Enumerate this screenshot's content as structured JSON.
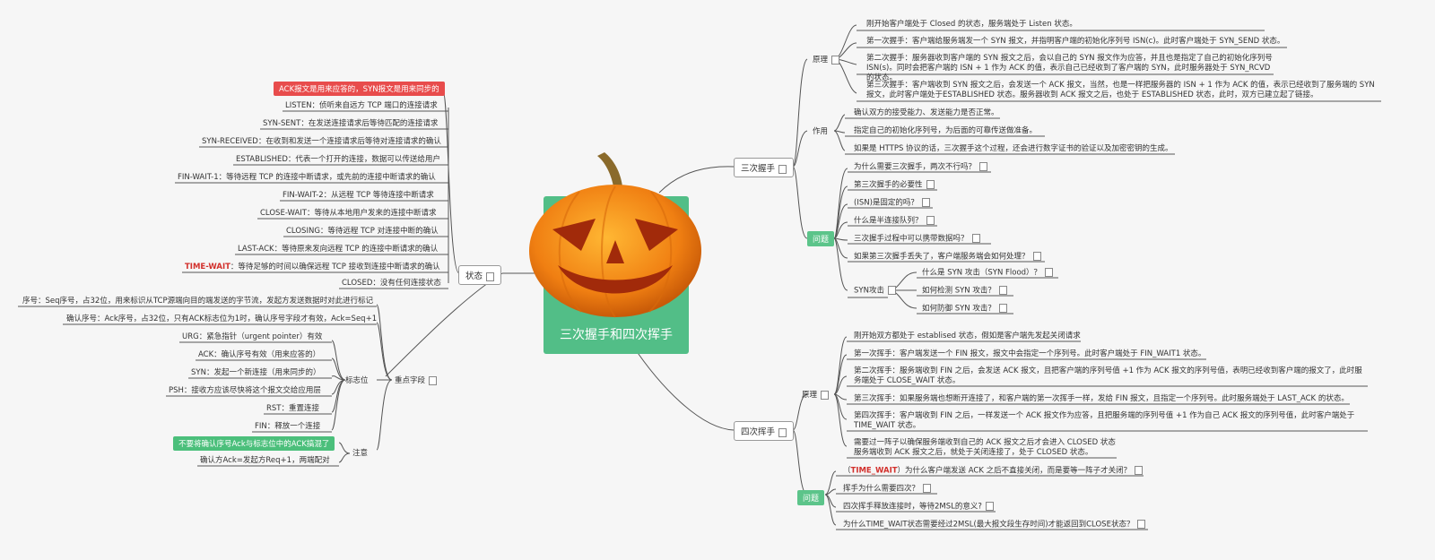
{
  "center": {
    "title": "三次握手和四次挥手"
  },
  "three_way": {
    "label": "三次握手",
    "principle": {
      "label": "原理",
      "items": [
        "刚开始客户端处于 Closed 的状态，服务端处于 Listen 状态。",
        "第一次握手：客户端给服务端发一个 SYN 报文，并指明客户端的初始化序列号 ISN(c)。此时客户端处于 SYN_SEND 状态。",
        "第二次握手：服务器收到客户端的 SYN 报文之后，会以自己的 SYN 报文作为应答，并且也是指定了自己的初始化序列号 ISN(s)。同时会把客户端的 ISN + 1 作为 ACK 的值，表示自己已经收到了客户端的 SYN，此时服务器处于 SYN_RCVD 的状态。",
        "第三次握手：客户端收到 SYN 报文之后，会发送一个 ACK 报文，当然，也是一样把服务器的 ISN + 1 作为 ACK 的值，表示已经收到了服务端的 SYN 报文，此时客户端处于ESTABLISHED 状态。服务器收到 ACK 报文之后，也处于 ESTABLISHED 状态，此时，双方已建立起了链接。"
      ]
    },
    "role": {
      "label": "作用",
      "items": [
        "确认双方的接受能力、发送能力是否正常。",
        "指定自己的初始化序列号，为后面的可靠传送做准备。",
        "如果是 HTTPS 协议的话，三次握手这个过程，还会进行数字证书的验证以及加密密钥的生成。"
      ]
    },
    "questions": {
      "label": "问题",
      "items": [
        "为什么需要三次握手，两次不行吗？",
        "第三次握手的必要性",
        "(ISN)是固定的吗？",
        "什么是半连接队列？",
        "三次握手过程中可以携带数据吗？",
        "如果第三次握手丢失了，客户端服务端会如何处理？"
      ],
      "syn": {
        "label": "SYN攻击",
        "items": [
          "什么是 SYN 攻击（SYN Flood）？",
          "如何检测 SYN 攻击？",
          "如何防御 SYN 攻击？"
        ]
      }
    }
  },
  "four_way": {
    "label": "四次挥手",
    "principle": {
      "label": "原理",
      "items": [
        "刚开始双方都处于 establised 状态，假如是客户端先发起关闭请求",
        "第一次挥手：客户端发送一个 FIN 报文，报文中会指定一个序列号。此时客户端处于 FIN_WAIT1 状态。",
        "第二次挥手：服务端收到 FIN 之后，会发送 ACK 报文，且把客户端的序列号值 +1 作为 ACK 报文的序列号值，表明已经收到客户端的报文了，此时服务端处于 CLOSE_WAIT 状态。",
        "第三次挥手：如果服务端也想断开连接了，和客户端的第一次挥手一样，发给 FIN 报文，且指定一个序列号。此时服务端处于 LAST_ACK 的状态。",
        "第四次挥手：客户端收到 FIN 之后，一样发送一个 ACK 报文作为应答，且把服务端的序列号值 +1 作为自己 ACK 报文的序列号值，此时客户端处于 TIME_WAIT 状态。",
        "需要过一阵子以确保服务端收到自己的 ACK 报文之后才会进入 CLOSED 状态\n服务端收到 ACK 报文之后，就处于关闭连接了，处于 CLOSED 状态。"
      ]
    },
    "questions": {
      "label": "问题",
      "items": [
        "（TIME_WAIT）为什么客户端发送 ACK 之后不直接关闭，而是要等一阵子才关闭？",
        "挥手为什么需要四次？",
        "四次挥手释放连接时，等待2MSL的意义?",
        "为什么TIME_WAIT状态需要经过2MSL(最大报文段生存时间)才能返回到CLOSE状态？"
      ]
    }
  },
  "states": {
    "label": "状态",
    "note": "ACK报文是用来应答的，SYN报文是用来同步的",
    "items": [
      "LISTEN：侦听来自远方 TCP 端口的连接请求",
      "SYN-SENT：在发送连接请求后等待匹配的连接请求",
      "SYN-RECEIVED：在收到和发送一个连接请求后等待对连接请求的确认",
      "ESTABLISHED：代表一个打开的连接，数据可以传送给用户",
      "FIN-WAIT-1：等待远程 TCP 的连接中断请求，或先前的连接中断请求的确认",
      "FIN-WAIT-2：从远程 TCP 等待连接中断请求",
      "CLOSE-WAIT：等待从本地用户发来的连接中断请求",
      "CLOSING：等待远程 TCP 对连接中断的确认",
      "LAST-ACK：等待原来发向远程 TCP 的连接中断请求的确认",
      "TIME-WAIT：等待足够的时间以确保远程 TCP 接收到连接中断请求的确认",
      "CLOSED：没有任何连接状态"
    ]
  },
  "fields": {
    "label": "重点字段",
    "seq": "序号：Seq序号，占32位，用来标识从TCP源端向目的端发送的字节流，发起方发送数据时对此进行标记",
    "ack": "确认序号：Ack序号，占32位，只有ACK标志位为1时，确认序号字段才有效，Ack=Seq+1",
    "flags": {
      "label": "标志位",
      "items": [
        "URG：紧急指针（urgent pointer）有效",
        "ACK：确认序号有效（用来应答的）",
        "SYN：发起一个新连接（用来同步的）",
        "PSH：接收方应该尽快将这个报文交给应用层",
        "RST：重置连接",
        "FIN：释放一个连接"
      ]
    },
    "notes": {
      "label": "注意",
      "tag": "不要将确认序号Ack与标志位中的ACK搞混了",
      "text": "确认方Ack=发起方Req+1，两端配对"
    }
  },
  "colors": {
    "accent_green": "#52be87",
    "accent_red": "#e84c4c",
    "line": "#555555"
  }
}
